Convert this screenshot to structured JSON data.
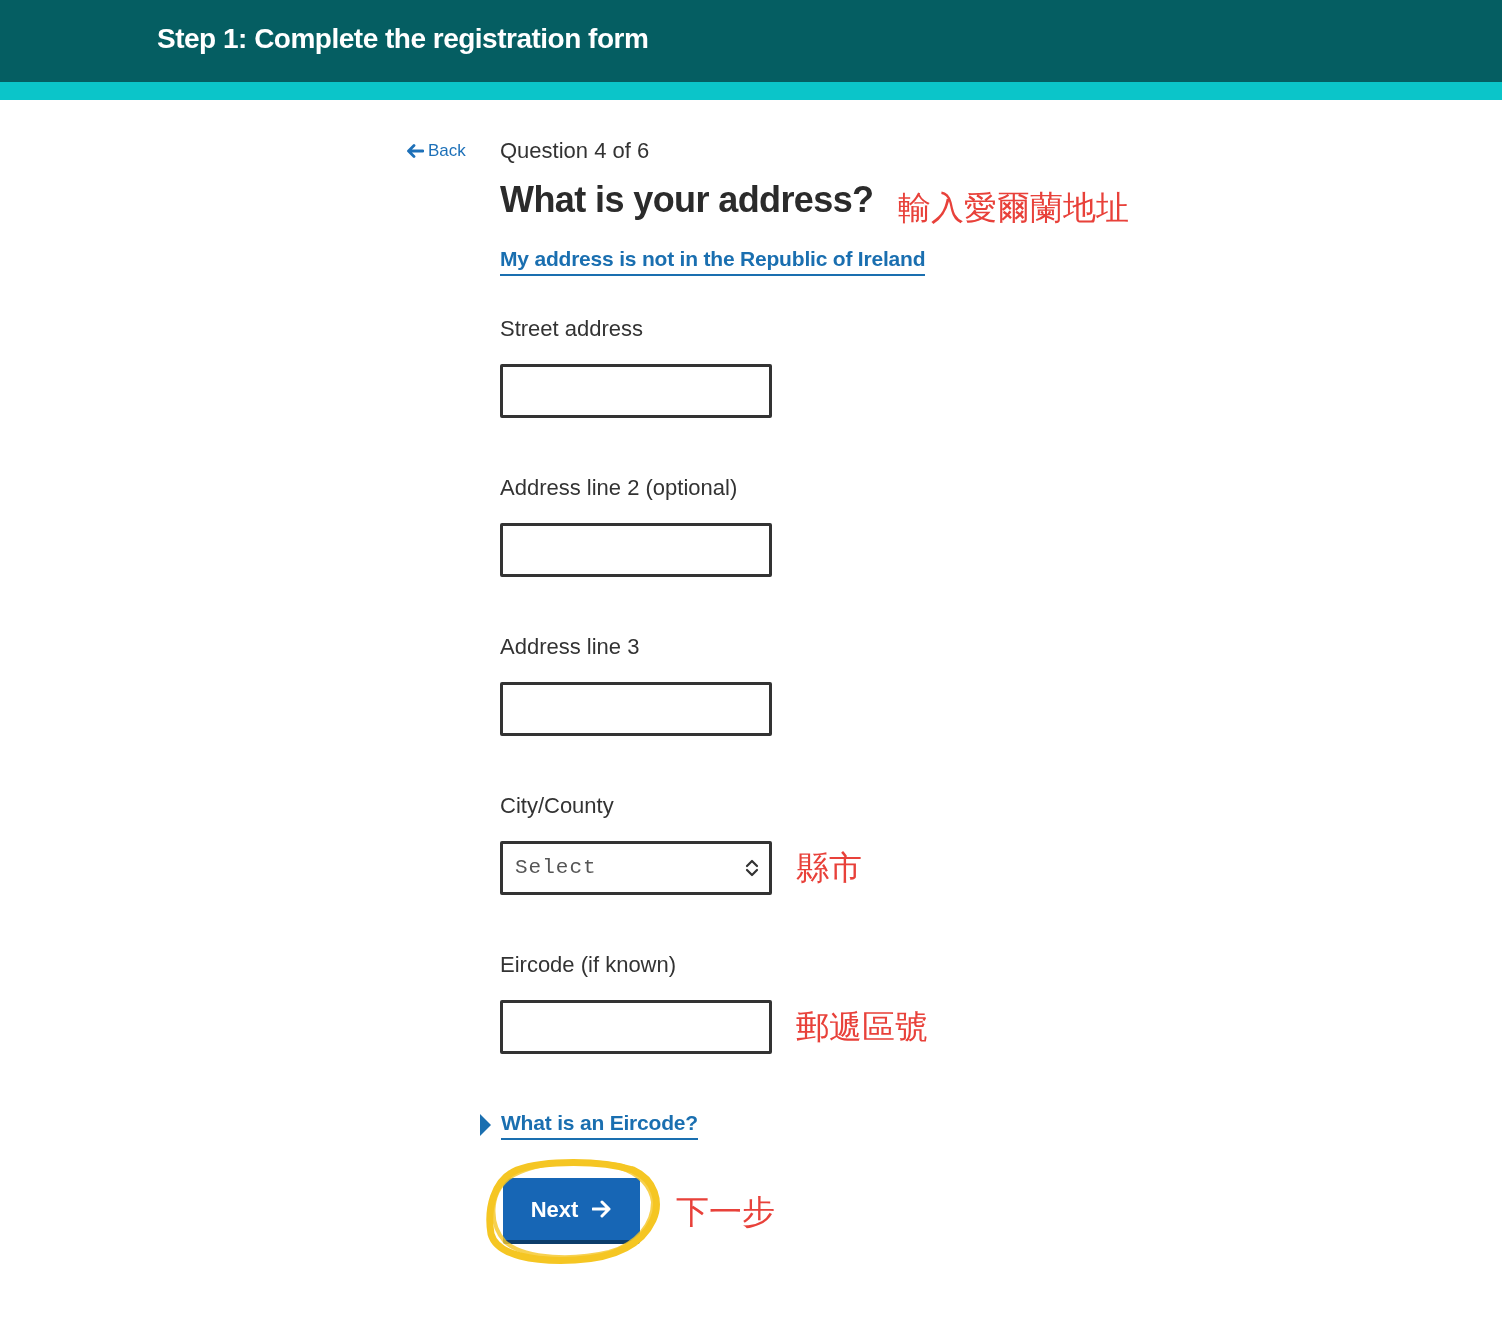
{
  "header": {
    "title": "Step 1: Complete the registration form"
  },
  "back_link": {
    "label": "Back"
  },
  "progress": "Question 4 of 6",
  "question": {
    "title": "What is your address?",
    "annotation": "輸入愛爾蘭地址"
  },
  "alt_link": "My address is not in the Republic of Ireland",
  "fields": [
    {
      "kind": "text",
      "label": "Street address"
    },
    {
      "kind": "text",
      "label": "Address line 2 (optional)"
    },
    {
      "kind": "text",
      "label": "Address line 3"
    },
    {
      "kind": "select",
      "label": "City/County",
      "value": "Select",
      "annotation": "縣市"
    },
    {
      "kind": "text",
      "label": "Eircode (if known)",
      "annotation": "郵遞區號"
    }
  ],
  "details": {
    "summary": "What is an Eircode?",
    "expanded": false
  },
  "next_button": {
    "label": "Next",
    "highlighted": true,
    "annotation": "下一步"
  }
}
